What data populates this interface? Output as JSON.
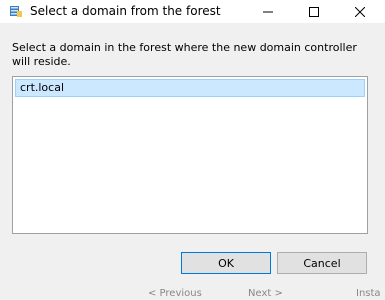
{
  "window": {
    "title": "Select a domain from the forest",
    "minimize_icon": "minimize-icon",
    "maximize_icon": "maximize-icon",
    "close_icon": "close-icon"
  },
  "dialog": {
    "instruction": "Select a domain in the forest where the new domain controller will reside.",
    "domains": [
      "crt.local"
    ],
    "selected_index": 0,
    "ok_label": "OK",
    "cancel_label": "Cancel"
  },
  "background_wizard": {
    "previous_label": "< Previous",
    "next_label": "Next >",
    "install_label": "Insta"
  },
  "colors": {
    "selection": "#cce8ff",
    "selection_border": "#99d1ff",
    "accent": "#0078d7"
  }
}
